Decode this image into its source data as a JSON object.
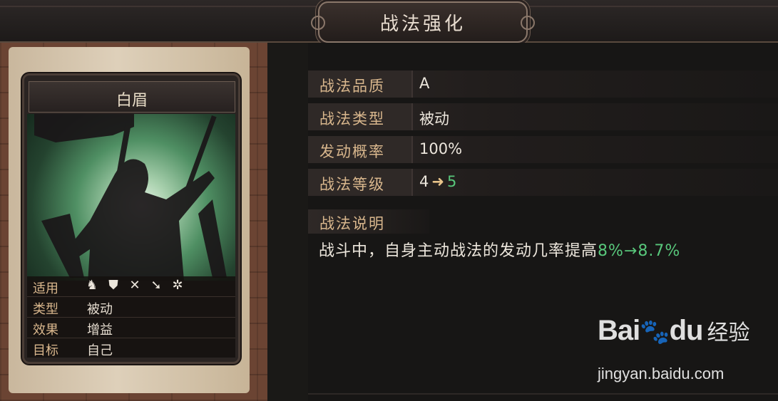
{
  "header": {
    "title": "战法强化"
  },
  "skill_card": {
    "name": "白眉",
    "stats": [
      {
        "label": "适用",
        "value": ""
      },
      {
        "label": "类型",
        "value": "被动"
      },
      {
        "label": "效果",
        "value": "增益"
      },
      {
        "label": "目标",
        "value": "自己"
      }
    ],
    "troop_icons": [
      "cavalry-icon",
      "shield-icon",
      "bow-icon",
      "spear-icon",
      "wheel-icon"
    ],
    "colors": {
      "art_glow": "#a9d1ae",
      "label": "#d9b78d"
    }
  },
  "attributes": [
    {
      "label": "战法品质",
      "value": "A"
    },
    {
      "label": "战法类型",
      "value": "被动"
    },
    {
      "label": "发动概率",
      "value": "100%"
    },
    {
      "label": "战法等级",
      "from": "4",
      "to": "5"
    }
  ],
  "description": {
    "title": "战法说明",
    "text": "战斗中，自身主动战法的发动几率提高",
    "highlight": "8%→8.7%"
  },
  "watermark": {
    "logo": "Bai",
    "logo2": "du",
    "text": "经验",
    "url": "jingyan.baidu.com"
  },
  "accent_colors": {
    "upgrade_green": "#58c77b",
    "arrow": "#e8c48a"
  }
}
